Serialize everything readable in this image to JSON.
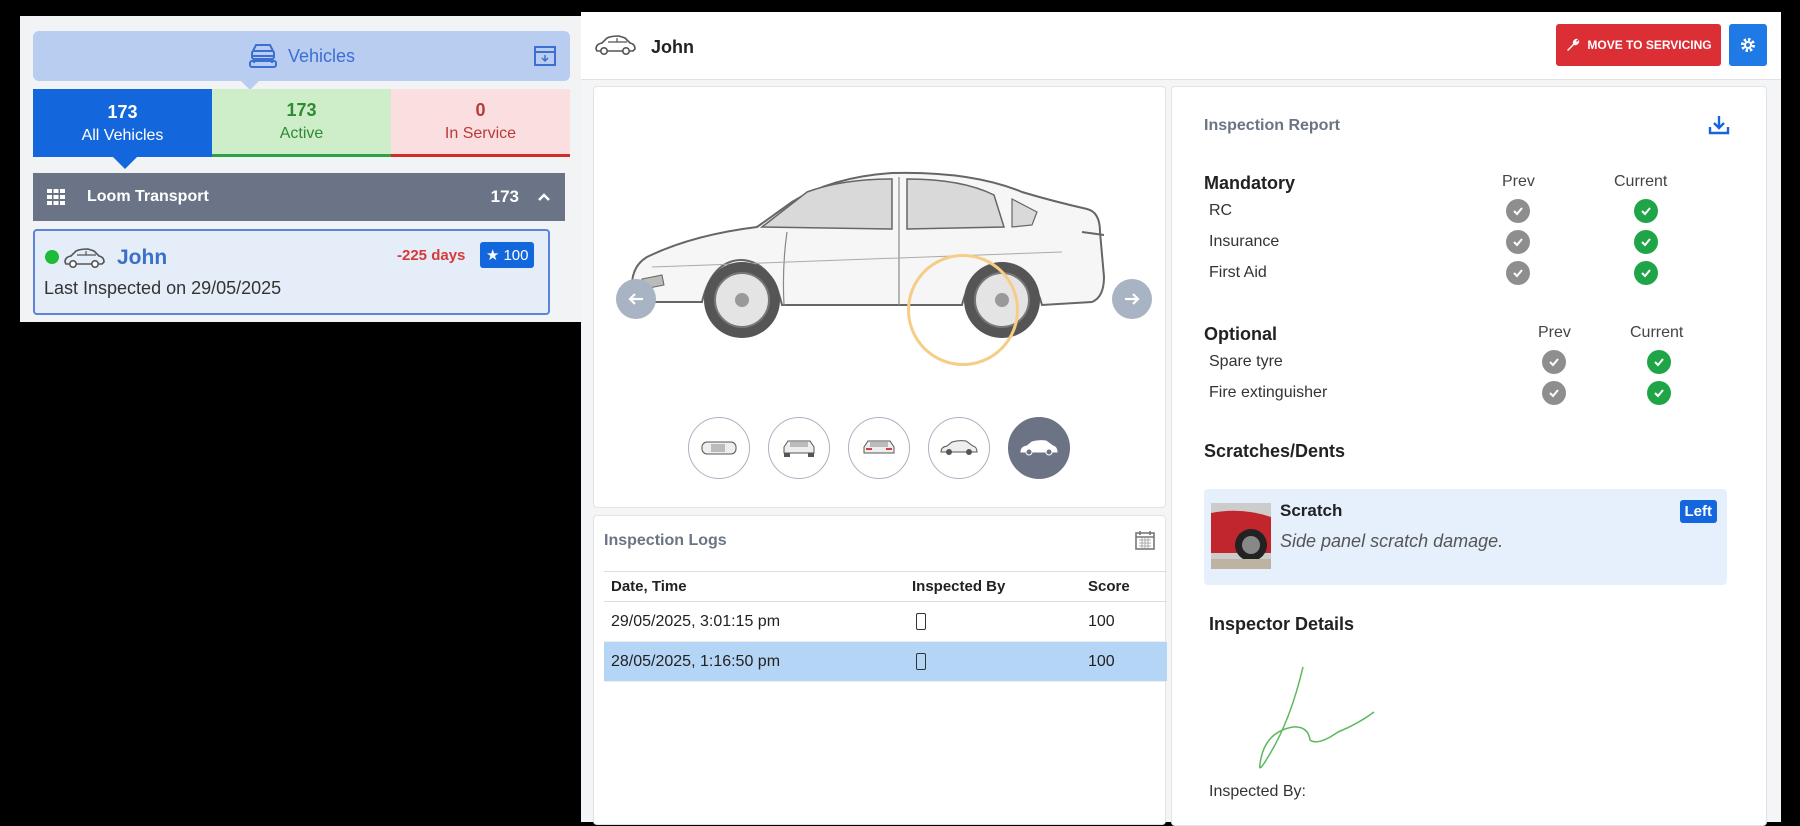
{
  "sidebar": {
    "header_label": "Vehicles",
    "stats": {
      "all": {
        "count": "173",
        "label": "All Vehicles"
      },
      "active": {
        "count": "173",
        "label": "Active"
      },
      "in_service": {
        "count": "0",
        "label": "In Service"
      }
    },
    "group": {
      "name": "Loom Transport",
      "count": "173"
    },
    "vehicle": {
      "name": "John",
      "days": "-225 days",
      "score": "100",
      "last_inspected": "Last Inspected on 29/05/2025"
    }
  },
  "header": {
    "vehicle_name": "John",
    "move_button": "MOVE TO SERVICING"
  },
  "logs": {
    "title": "Inspection Logs",
    "columns": [
      "Date, Time",
      "Inspected By",
      "Score"
    ],
    "rows": [
      {
        "datetime": "29/05/2025, 3:01:15 pm",
        "score": "100"
      },
      {
        "datetime": "28/05/2025, 1:16:50 pm",
        "score": "100"
      }
    ]
  },
  "report": {
    "title": "Inspection Report",
    "mandatory": {
      "heading": "Mandatory",
      "prev": "Prev",
      "current": "Current",
      "items": [
        "RC",
        "Insurance",
        "First Aid"
      ]
    },
    "optional": {
      "heading": "Optional",
      "prev": "Prev",
      "current": "Current",
      "items": [
        "Spare tyre",
        "Fire extinguisher"
      ]
    },
    "scratches_heading": "Scratches/Dents",
    "scratch": {
      "title": "Scratch",
      "description": "Side panel scratch damage.",
      "side": "Left"
    },
    "inspector_heading": "Inspector Details",
    "inspected_by": "Inspected By:"
  },
  "colors": {
    "primary": "#1466dc",
    "danger": "#dc2f35",
    "success": "#1fa547"
  }
}
